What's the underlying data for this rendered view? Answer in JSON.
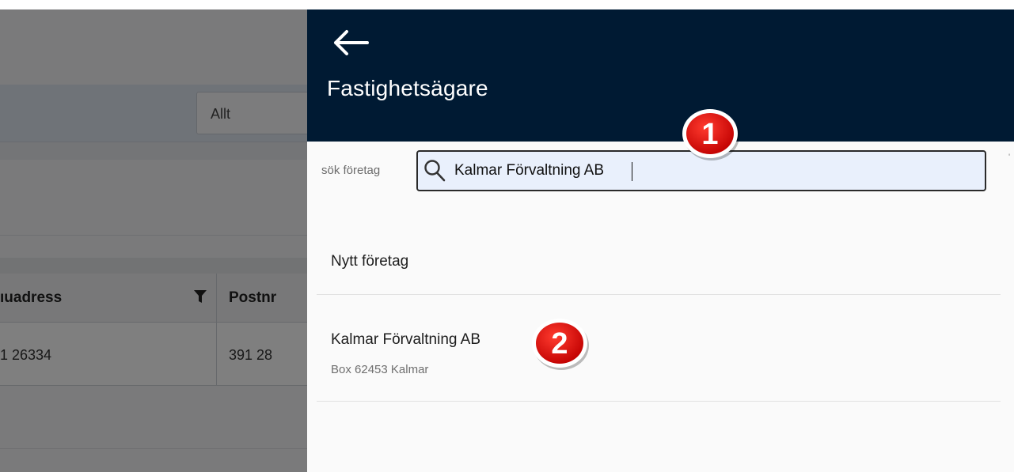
{
  "background": {
    "filter_select_value": "Allt",
    "table": {
      "columns": [
        "ıuadress",
        "Postnr"
      ],
      "rows": [
        [
          "1 26334",
          "391 28"
        ]
      ]
    }
  },
  "panel": {
    "title": "Fastighetsägare",
    "search": {
      "label": "sök företag",
      "value": "Kalmar Förvaltning AB"
    },
    "new_company_label": "Nytt företag",
    "results": [
      {
        "name": "Kalmar Förvaltning AB",
        "address": "Box 62453 Kalmar"
      }
    ]
  },
  "callouts": [
    "1",
    "2"
  ],
  "colors": {
    "header_bg": "#001a33",
    "search_bg": "#e9f0fc",
    "badge_red": "#d10000"
  },
  "icons": [
    "arrow-left-icon",
    "search-icon",
    "filter-icon"
  ]
}
